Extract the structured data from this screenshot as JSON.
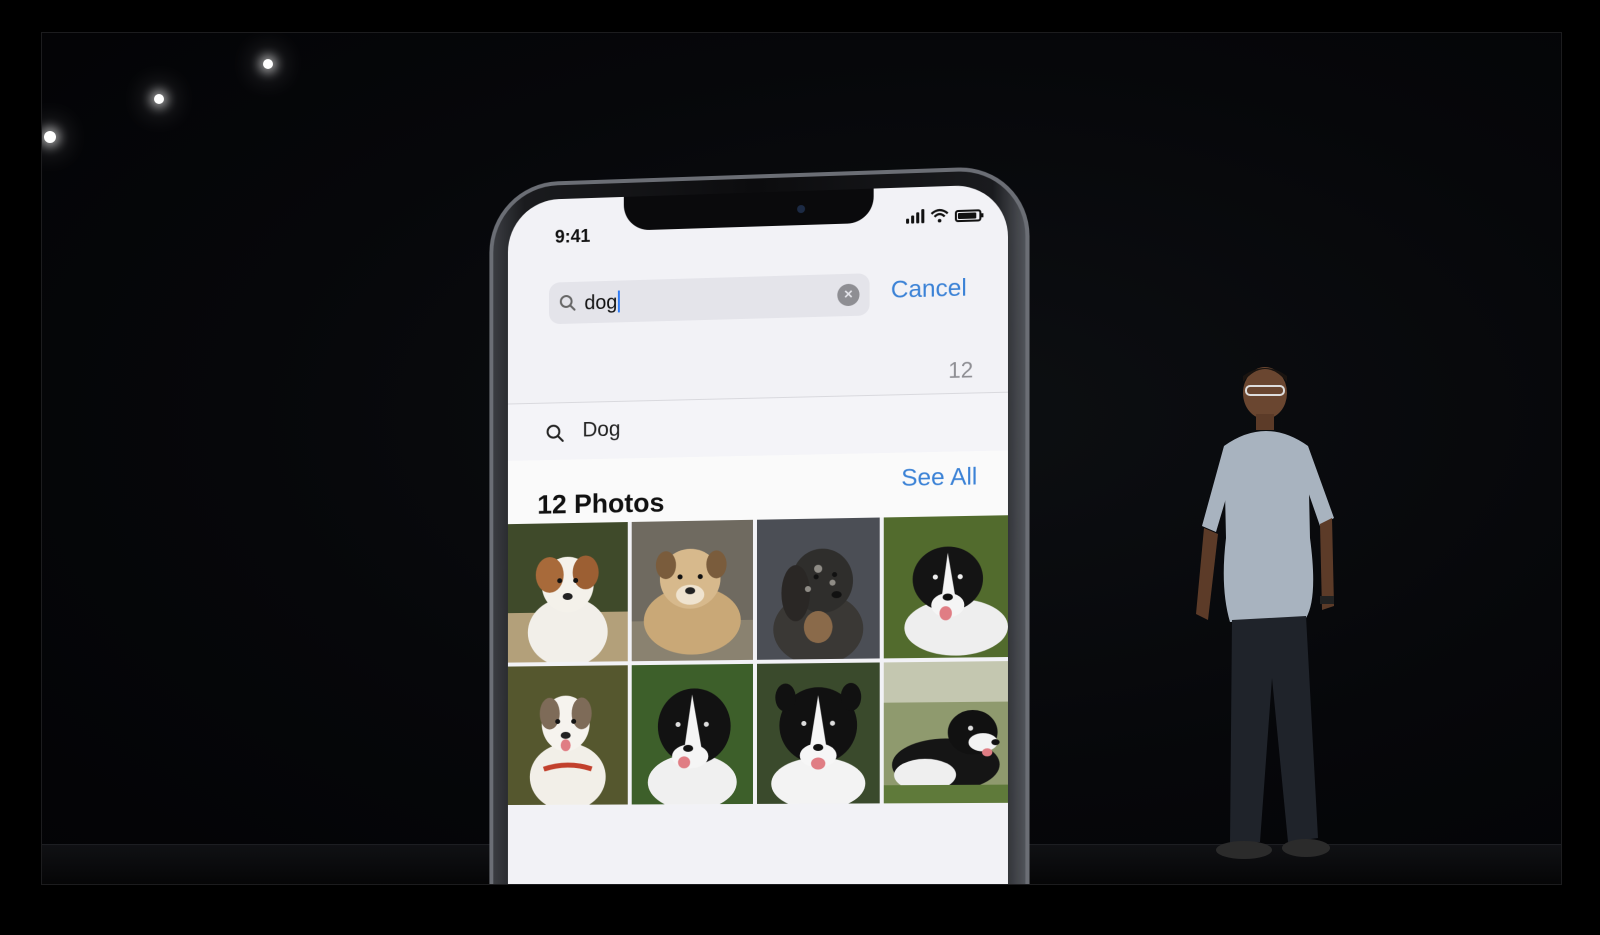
{
  "scene": {
    "description_kind": "keynote-stage"
  },
  "phone": {
    "status_time": "9:41",
    "search": {
      "query": "dog",
      "cancel_label": "Cancel"
    },
    "result_count": "12",
    "suggestion": "Dog",
    "section": {
      "title": "12 Photos",
      "see_all_label": "See All"
    },
    "photos": [
      {
        "name": "dog-photo-1"
      },
      {
        "name": "dog-photo-2"
      },
      {
        "name": "dog-photo-3"
      },
      {
        "name": "dog-photo-4"
      },
      {
        "name": "dog-photo-5"
      },
      {
        "name": "dog-photo-6"
      },
      {
        "name": "dog-photo-7"
      },
      {
        "name": "dog-photo-8"
      }
    ]
  },
  "colors": {
    "accent": "#3b82d6",
    "stage_background": "#06070a"
  },
  "icons": [
    "search-icon",
    "clear-icon",
    "wifi-icon",
    "signal-icon",
    "battery-icon"
  ]
}
